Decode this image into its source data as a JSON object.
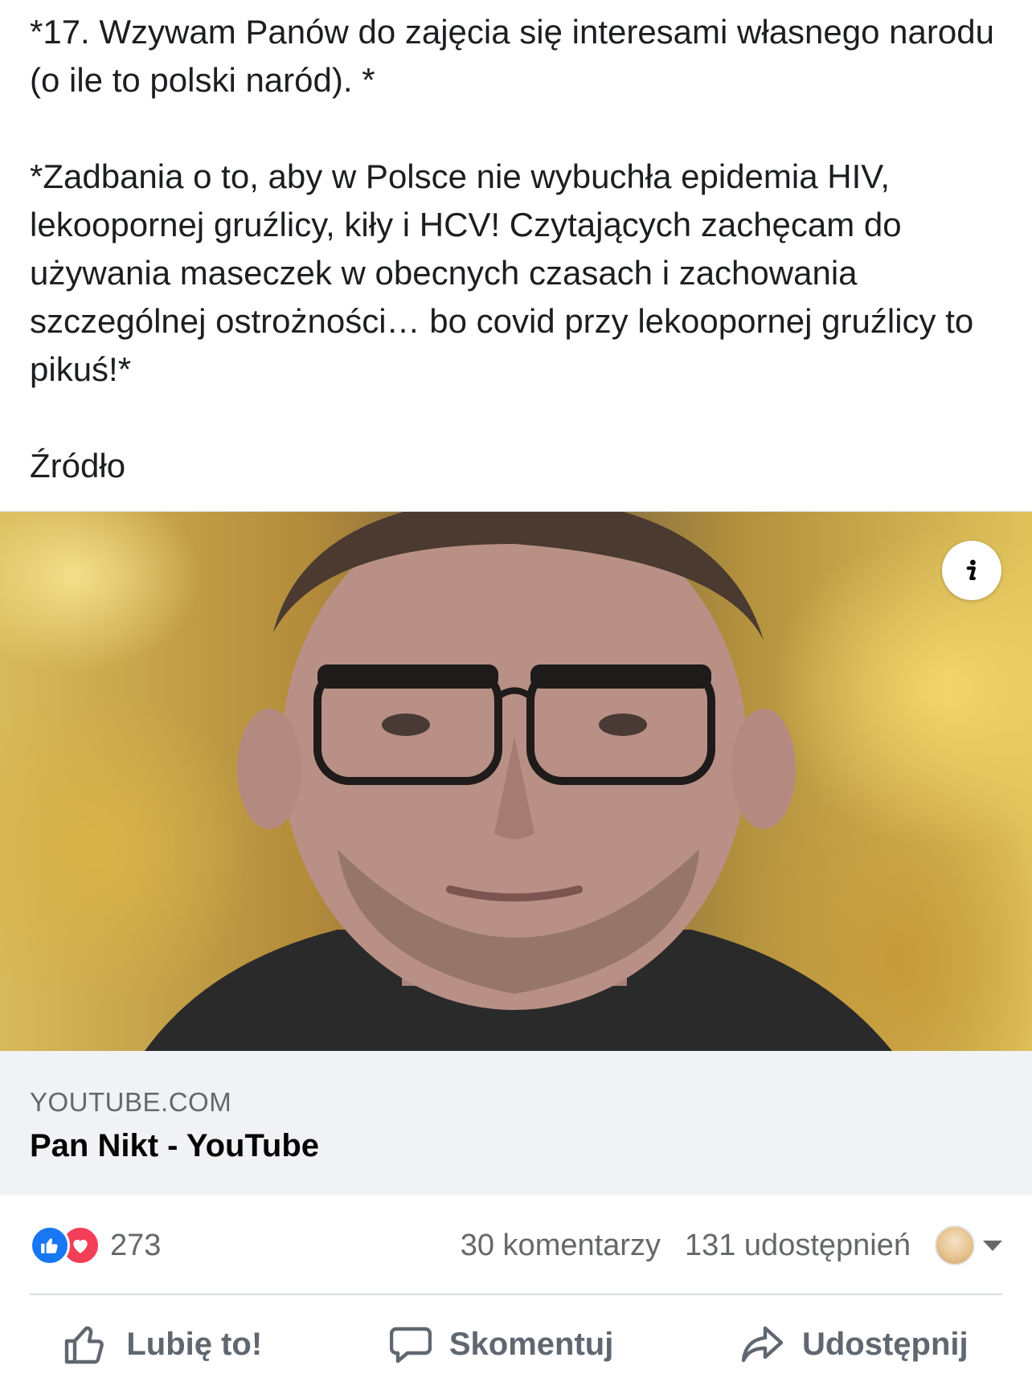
{
  "post": {
    "paragraphs": [
      "*17. Wzywam Panów do zajęcia się interesami własnego narodu (o ile to polski naród). *",
      "*Zadbania o to, aby w Polsce nie wybuchła epidemia HIV, lekoopornej gruźlicy, kiły i HCV! Czytających zachęcam do używania maseczek w obecnych czasach i zachowania szczególnej ostrożności… bo covid przy lekoopornej gruźlicy to pikuś!*",
      "Źródło"
    ]
  },
  "link_card": {
    "domain": "YOUTUBE.COM",
    "title": "Pan Nikt - YouTube",
    "info_icon": "info-icon"
  },
  "stats": {
    "reactions": [
      "like-icon",
      "love-icon"
    ],
    "reaction_count": "273",
    "comments": "30 komentarzy",
    "shares": "131 udostępnień"
  },
  "actions": {
    "like": "Lubię to!",
    "comment": "Skomentuj",
    "share": "Udostępnij"
  },
  "colors": {
    "like_blue": "#1877f2",
    "love_red": "#f33e58",
    "secondary_text": "#65676b",
    "card_bg": "#f0f2f5"
  }
}
